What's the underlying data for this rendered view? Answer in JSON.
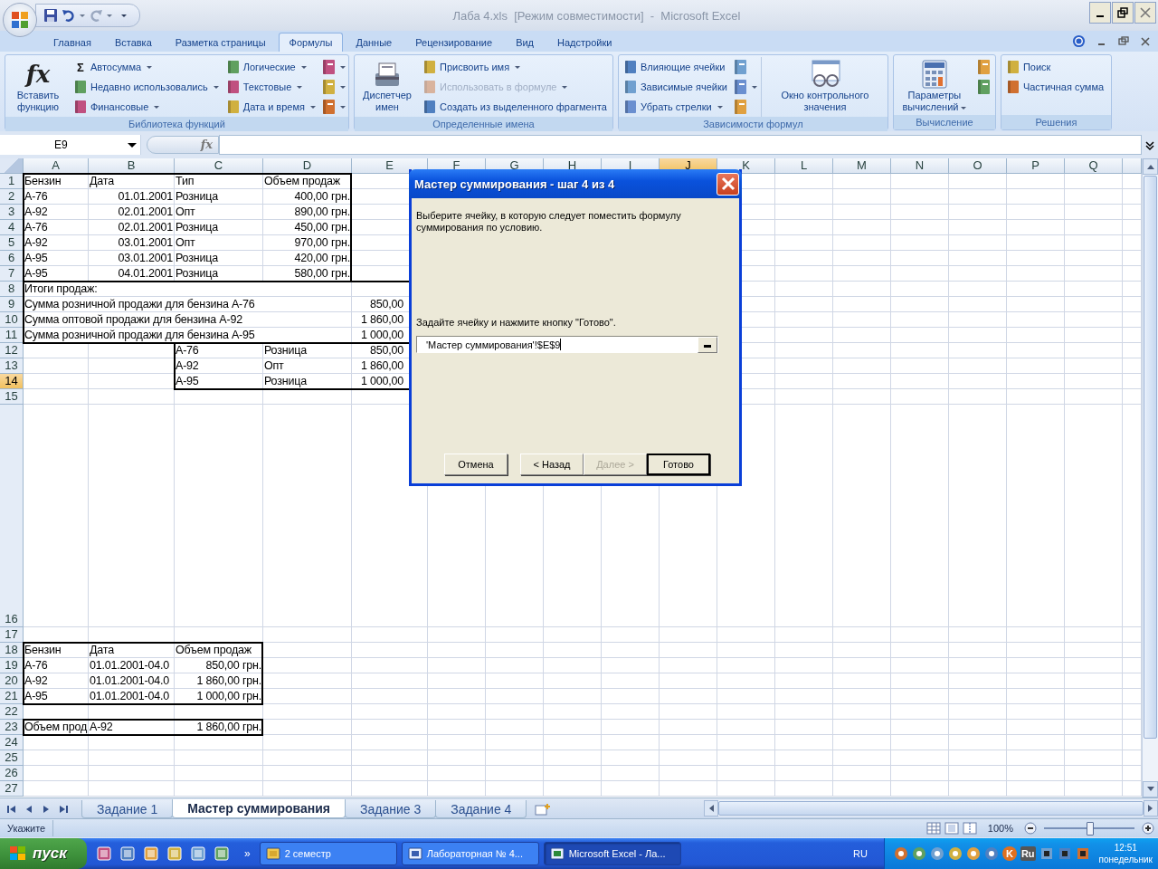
{
  "window": {
    "title": "Лаба 4.xls  [Режим совместимости]  -  Microsoft Excel"
  },
  "tabs": [
    {
      "label": "Главная",
      "selected": false
    },
    {
      "label": "Вставка",
      "selected": false
    },
    {
      "label": "Разметка страницы",
      "selected": false
    },
    {
      "label": "Формулы",
      "selected": true
    },
    {
      "label": "Данные",
      "selected": false
    },
    {
      "label": "Рецензирование",
      "selected": false
    },
    {
      "label": "Вид",
      "selected": false
    },
    {
      "label": "Надстройки",
      "selected": false
    }
  ],
  "ribbon": {
    "groups": [
      {
        "label": "Библиотека функций",
        "columns": [
          [
            {
              "kind": "large",
              "label": "Вставить функцию",
              "glyph": "fx",
              "dropdown": false
            }
          ],
          [
            {
              "kind": "small",
              "label": "Автосумма",
              "glyph": "Σ",
              "dropdown": true,
              "disabled": false
            },
            {
              "kind": "small",
              "label": "Недавно использовались",
              "dropdown": true,
              "disabled": false
            },
            {
              "kind": "small",
              "label": "Финансовые",
              "dropdown": true,
              "disabled": false
            }
          ],
          [
            {
              "kind": "small",
              "label": "Логические",
              "dropdown": true,
              "disabled": false
            },
            {
              "kind": "small",
              "label": "Текстовые",
              "dropdown": true,
              "disabled": false
            },
            {
              "kind": "small",
              "label": "Дата и время",
              "dropdown": true,
              "disabled": false
            }
          ],
          [
            {
              "kind": "icon",
              "dropdown": true
            },
            {
              "kind": "icon",
              "dropdown": true
            },
            {
              "kind": "icon",
              "dropdown": true
            }
          ]
        ]
      },
      {
        "label": "Определенные имена",
        "columns": [
          [
            {
              "kind": "large",
              "label": "Диспетчер имен",
              "dropdown": false
            }
          ],
          [
            {
              "kind": "small",
              "label": "Присвоить имя",
              "dropdown": true,
              "disabled": false
            },
            {
              "kind": "small",
              "label": "Использовать в формуле",
              "dropdown": true,
              "disabled": true
            },
            {
              "kind": "small",
              "label": "Создать из выделенного фрагмента",
              "dropdown": false,
              "disabled": false
            }
          ]
        ]
      },
      {
        "label": "Зависимости формул",
        "columns": [
          [
            {
              "kind": "small",
              "label": "Влияющие ячейки",
              "dropdown": false,
              "disabled": false
            },
            {
              "kind": "small",
              "label": "Зависимые ячейки",
              "dropdown": false,
              "disabled": false
            },
            {
              "kind": "small",
              "label": "Убрать стрелки",
              "dropdown": true,
              "disabled": false
            }
          ],
          [
            {
              "kind": "icon",
              "dropdown": false
            },
            {
              "kind": "icon",
              "dropdown": true
            },
            {
              "kind": "icon",
              "dropdown": false
            }
          ],
          [
            {
              "kind": "large",
              "label": "Окно контрольного значения",
              "dropdown": false
            }
          ]
        ]
      },
      {
        "label": "Вычисление",
        "columns": [
          [
            {
              "kind": "large",
              "label": "Параметры вычислений",
              "dropdown": true
            }
          ],
          [
            {
              "kind": "icon",
              "dropdown": false
            },
            {
              "kind": "icon",
              "dropdown": false
            }
          ]
        ]
      },
      {
        "label": "Решения",
        "columns": [
          [
            {
              "kind": "small",
              "label": "Поиск",
              "dropdown": false,
              "disabled": false
            },
            {
              "kind": "small",
              "label": "Частичная сумма",
              "dropdown": false,
              "disabled": false
            }
          ]
        ]
      }
    ]
  },
  "formula_bar": {
    "name_box": "E9",
    "fx_label": "fx"
  },
  "sheet": {
    "columns": [
      {
        "label": "A",
        "selected": false
      },
      {
        "label": "B",
        "selected": false
      },
      {
        "label": "C",
        "selected": false
      },
      {
        "label": "D",
        "selected": false
      },
      {
        "label": "E",
        "selected": false
      },
      {
        "label": "F",
        "selected": false
      },
      {
        "label": "G",
        "selected": false
      },
      {
        "label": "H",
        "selected": false
      },
      {
        "label": "I",
        "selected": false
      },
      {
        "label": "J",
        "selected": true
      },
      {
        "label": "K",
        "selected": false
      },
      {
        "label": "L",
        "selected": false
      },
      {
        "label": "M",
        "selected": false
      },
      {
        "label": "N",
        "selected": false
      },
      {
        "label": "O",
        "selected": false
      },
      {
        "label": "P",
        "selected": false
      },
      {
        "label": "Q",
        "selected": false
      }
    ],
    "rows": [
      {
        "label": "1",
        "selected": false,
        "cells": {
          "A": {
            "text": "Бензин",
            "kind": "text"
          },
          "B": {
            "text": "Дата",
            "kind": "text"
          },
          "C": {
            "text": "Тип",
            "kind": "text"
          },
          "D": {
            "text": "Объем продаж",
            "kind": "text"
          }
        }
      },
      {
        "label": "2",
        "selected": false,
        "cells": {
          "A": {
            "text": "А-76",
            "kind": "text"
          },
          "B": {
            "text": "01.01.2001",
            "kind": "number"
          },
          "C": {
            "text": "Розница",
            "kind": "text"
          },
          "D": {
            "text": "400,00 грн.",
            "kind": "number"
          }
        }
      },
      {
        "label": "3",
        "selected": false,
        "cells": {
          "A": {
            "text": "А-92",
            "kind": "text"
          },
          "B": {
            "text": "02.01.2001",
            "kind": "number"
          },
          "C": {
            "text": "Опт",
            "kind": "text"
          },
          "D": {
            "text": "890,00 грн.",
            "kind": "number"
          }
        }
      },
      {
        "label": "4",
        "selected": false,
        "cells": {
          "A": {
            "text": "А-76",
            "kind": "text"
          },
          "B": {
            "text": "02.01.2001",
            "kind": "number"
          },
          "C": {
            "text": "Розница",
            "kind": "text"
          },
          "D": {
            "text": "450,00 грн.",
            "kind": "number"
          }
        }
      },
      {
        "label": "5",
        "selected": false,
        "cells": {
          "A": {
            "text": "А-92",
            "kind": "text"
          },
          "B": {
            "text": "03.01.2001",
            "kind": "number"
          },
          "C": {
            "text": "Опт",
            "kind": "text"
          },
          "D": {
            "text": "970,00 грн.",
            "kind": "number"
          }
        }
      },
      {
        "label": "6",
        "selected": false,
        "cells": {
          "A": {
            "text": "А-95",
            "kind": "text"
          },
          "B": {
            "text": "03.01.2001",
            "kind": "number"
          },
          "C": {
            "text": "Розница",
            "kind": "text"
          },
          "D": {
            "text": "420,00 грн.",
            "kind": "number"
          }
        }
      },
      {
        "label": "7",
        "selected": false,
        "cells": {
          "A": {
            "text": "А-95",
            "kind": "text"
          },
          "B": {
            "text": "04.01.2001",
            "kind": "number"
          },
          "C": {
            "text": "Розница",
            "kind": "text"
          },
          "D": {
            "text": "580,00 грн.",
            "kind": "number"
          }
        }
      },
      {
        "label": "8",
        "selected": false,
        "cells": {
          "A:D": {
            "text": "Итоги продаж:",
            "kind": "text"
          }
        }
      },
      {
        "label": "9",
        "selected": false,
        "cells": {
          "A:D": {
            "text": "Сумма розничной продажи для бензина А-76",
            "kind": "text"
          },
          "E": {
            "text": "850,00",
            "kind": "number"
          }
        }
      },
      {
        "label": "10",
        "selected": false,
        "cells": {
          "A:D": {
            "text": "Сумма оптовой продажи для бензина А-92",
            "kind": "text"
          },
          "E": {
            "text": "1 860,00",
            "kind": "number"
          }
        }
      },
      {
        "label": "11",
        "selected": false,
        "cells": {
          "A:D": {
            "text": "Сумма розничной продажи для бензина А-95",
            "kind": "text"
          },
          "E": {
            "text": "1 000,00",
            "kind": "number"
          }
        }
      },
      {
        "label": "12",
        "selected": false,
        "cells": {
          "C": {
            "text": "А-76",
            "kind": "text"
          },
          "D": {
            "text": "Розница",
            "kind": "text"
          },
          "E": {
            "text": "850,00",
            "kind": "number"
          }
        }
      },
      {
        "label": "13",
        "selected": false,
        "cells": {
          "C": {
            "text": "А-92",
            "kind": "text"
          },
          "D": {
            "text": "Опт",
            "kind": "text"
          },
          "E": {
            "text": "1 860,00",
            "kind": "number"
          }
        }
      },
      {
        "label": "14",
        "selected": true,
        "cells": {
          "C": {
            "text": "А-95",
            "kind": "text"
          },
          "D": {
            "text": "Розница",
            "kind": "text"
          },
          "E": {
            "text": "1 000,00",
            "kind": "number"
          }
        }
      },
      {
        "label": "15",
        "selected": false
      },
      {
        "label": "16",
        "selected": false
      },
      {
        "label": "17",
        "selected": false
      },
      {
        "label": "18",
        "selected": false,
        "cells": {
          "A": {
            "text": "Бензин",
            "kind": "text"
          },
          "B": {
            "text": "Дата",
            "kind": "text"
          },
          "C": {
            "text": "Объем продаж",
            "kind": "text"
          }
        }
      },
      {
        "label": "19",
        "selected": false,
        "cells": {
          "A": {
            "text": "А-76",
            "kind": "text"
          },
          "B": {
            "text": "01.01.2001-04.0",
            "kind": "text"
          },
          "C": {
            "text": "850,00 грн.",
            "kind": "number"
          }
        }
      },
      {
        "label": "20",
        "selected": false,
        "cells": {
          "A": {
            "text": "А-92",
            "kind": "text"
          },
          "B": {
            "text": "01.01.2001-04.0",
            "kind": "text"
          },
          "C": {
            "text": "1 860,00 грн.",
            "kind": "number"
          }
        }
      },
      {
        "label": "21",
        "selected": false,
        "cells": {
          "A": {
            "text": "А-95",
            "kind": "text"
          },
          "B": {
            "text": "01.01.2001-04.0",
            "kind": "text"
          },
          "C": {
            "text": "1 000,00 грн.",
            "kind": "number"
          }
        }
      },
      {
        "label": "22",
        "selected": false
      },
      {
        "label": "23",
        "selected": false,
        "cells": {
          "A": {
            "text": "Объем прод",
            "kind": "text"
          },
          "B": {
            "text": "А-92",
            "kind": "text"
          },
          "C": {
            "text": "1 860,00 грн.",
            "kind": "number"
          }
        }
      },
      {
        "label": "24",
        "selected": false
      },
      {
        "label": "25",
        "selected": false
      },
      {
        "label": "26",
        "selected": false
      },
      {
        "label": "27",
        "selected": false
      }
    ]
  },
  "dialog": {
    "title": "Мастер суммирования - шаг 4 из 4",
    "prompt": "Выберите ячейку, в которую следует поместить формулу суммирования по условию.",
    "instruction": "Задайте ячейку и нажмите кнопку \"Готово\".",
    "reference": "'Мастер суммирования'!$E$9",
    "buttons": [
      {
        "label": "Отмена",
        "disabled": false,
        "default": false
      },
      {
        "label": "< Назад",
        "disabled": false,
        "default": false
      },
      {
        "label": "Далее >",
        "disabled": true,
        "default": false
      },
      {
        "label": "Готово",
        "disabled": false,
        "default": true
      }
    ]
  },
  "sheet_tabs": [
    {
      "label": "Задание 1",
      "selected": false
    },
    {
      "label": "Мастер суммирования",
      "selected": true
    },
    {
      "label": "Задание 3",
      "selected": false
    },
    {
      "label": "Задание 4",
      "selected": false
    }
  ],
  "status_bar": {
    "mode": "Укажите",
    "zoom": {
      "reading": "100%",
      "level": 0.5
    }
  },
  "taskbar": {
    "start": "пуск",
    "overflow": "»",
    "tasks": [
      {
        "label": "2 семестр",
        "selected": false
      },
      {
        "label": "Лабораторная № 4...",
        "selected": false
      },
      {
        "label": "Microsoft Excel - Ла...",
        "selected": true
      }
    ],
    "language": "RU",
    "tray_texts": [
      "K",
      "Ru"
    ],
    "time": "12:51",
    "day": "понедельник"
  }
}
